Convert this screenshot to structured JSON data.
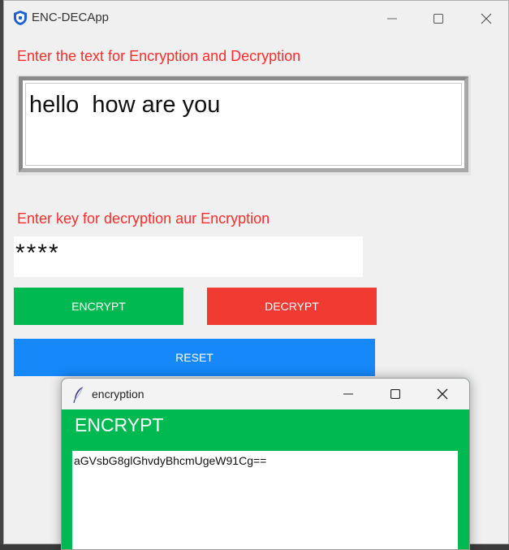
{
  "window": {
    "title": "ENC-DECApp"
  },
  "form": {
    "text_label": "Enter the text for Encryption and Decryption",
    "text_value": "hello  how are you",
    "key_label": "Enter key for decryption aur Encryption",
    "key_value": "****"
  },
  "buttons": {
    "encrypt": "ENCRYPT",
    "decrypt": "DECRYPT",
    "reset": "RESET"
  },
  "popup": {
    "title": "encryption",
    "heading": "ENCRYPT",
    "output": "aGVsbG8glGhvdyBhcmUgeW91Cg=="
  },
  "icons": {
    "app": "shield-icon",
    "popup": "feather-icon",
    "minimize": "minimize-icon",
    "maximize": "maximize-icon",
    "close": "close-icon"
  },
  "colors": {
    "label": "#ff2b2b",
    "encrypt": "#00b951",
    "decrypt": "#f03a32",
    "reset": "#1688fa",
    "popup_bg": "#00b951"
  }
}
